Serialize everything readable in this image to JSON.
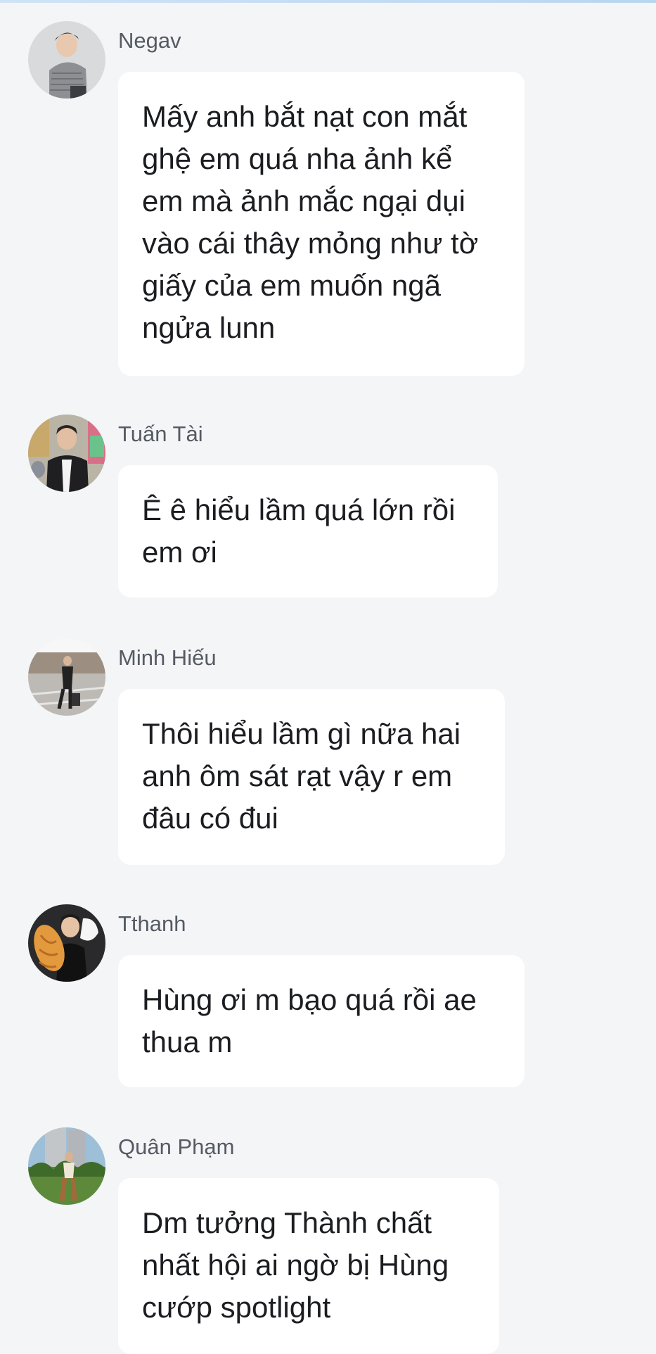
{
  "messages": [
    {
      "sender": "Negav",
      "avatar": "avatar-negav",
      "text": "Mấy anh bắt nạt con mắt ghệ em quá nha ảnh kể em mà ảnh mắc ngại dụi vào cái thây mỏng như tờ giấy của em muốn ngã ngửa lunn"
    },
    {
      "sender": "Tuấn Tài",
      "avatar": "avatar-tuan-tai",
      "text": "Ê ê hiểu lầm quá lớn rồi em ơi"
    },
    {
      "sender": "Minh Hiếu",
      "avatar": "avatar-minh-hieu",
      "text": "Thôi hiểu lầm gì nữa hai anh ôm sát rạt vậy r em đâu có đui"
    },
    {
      "sender": "Tthanh",
      "avatar": "avatar-tthanh",
      "text": "Hùng ơi m bạo quá rồi ae thua m"
    },
    {
      "sender": "Quân Phạm",
      "avatar": "avatar-quan-pham",
      "text": "Dm tưởng Thành chất nhất hội ai ngờ bị Hùng cướp spotlight"
    }
  ],
  "colors": {
    "background": "#f4f5f7",
    "bubble": "#ffffff",
    "sender_text": "#555a63",
    "message_text": "#1c1d21"
  }
}
